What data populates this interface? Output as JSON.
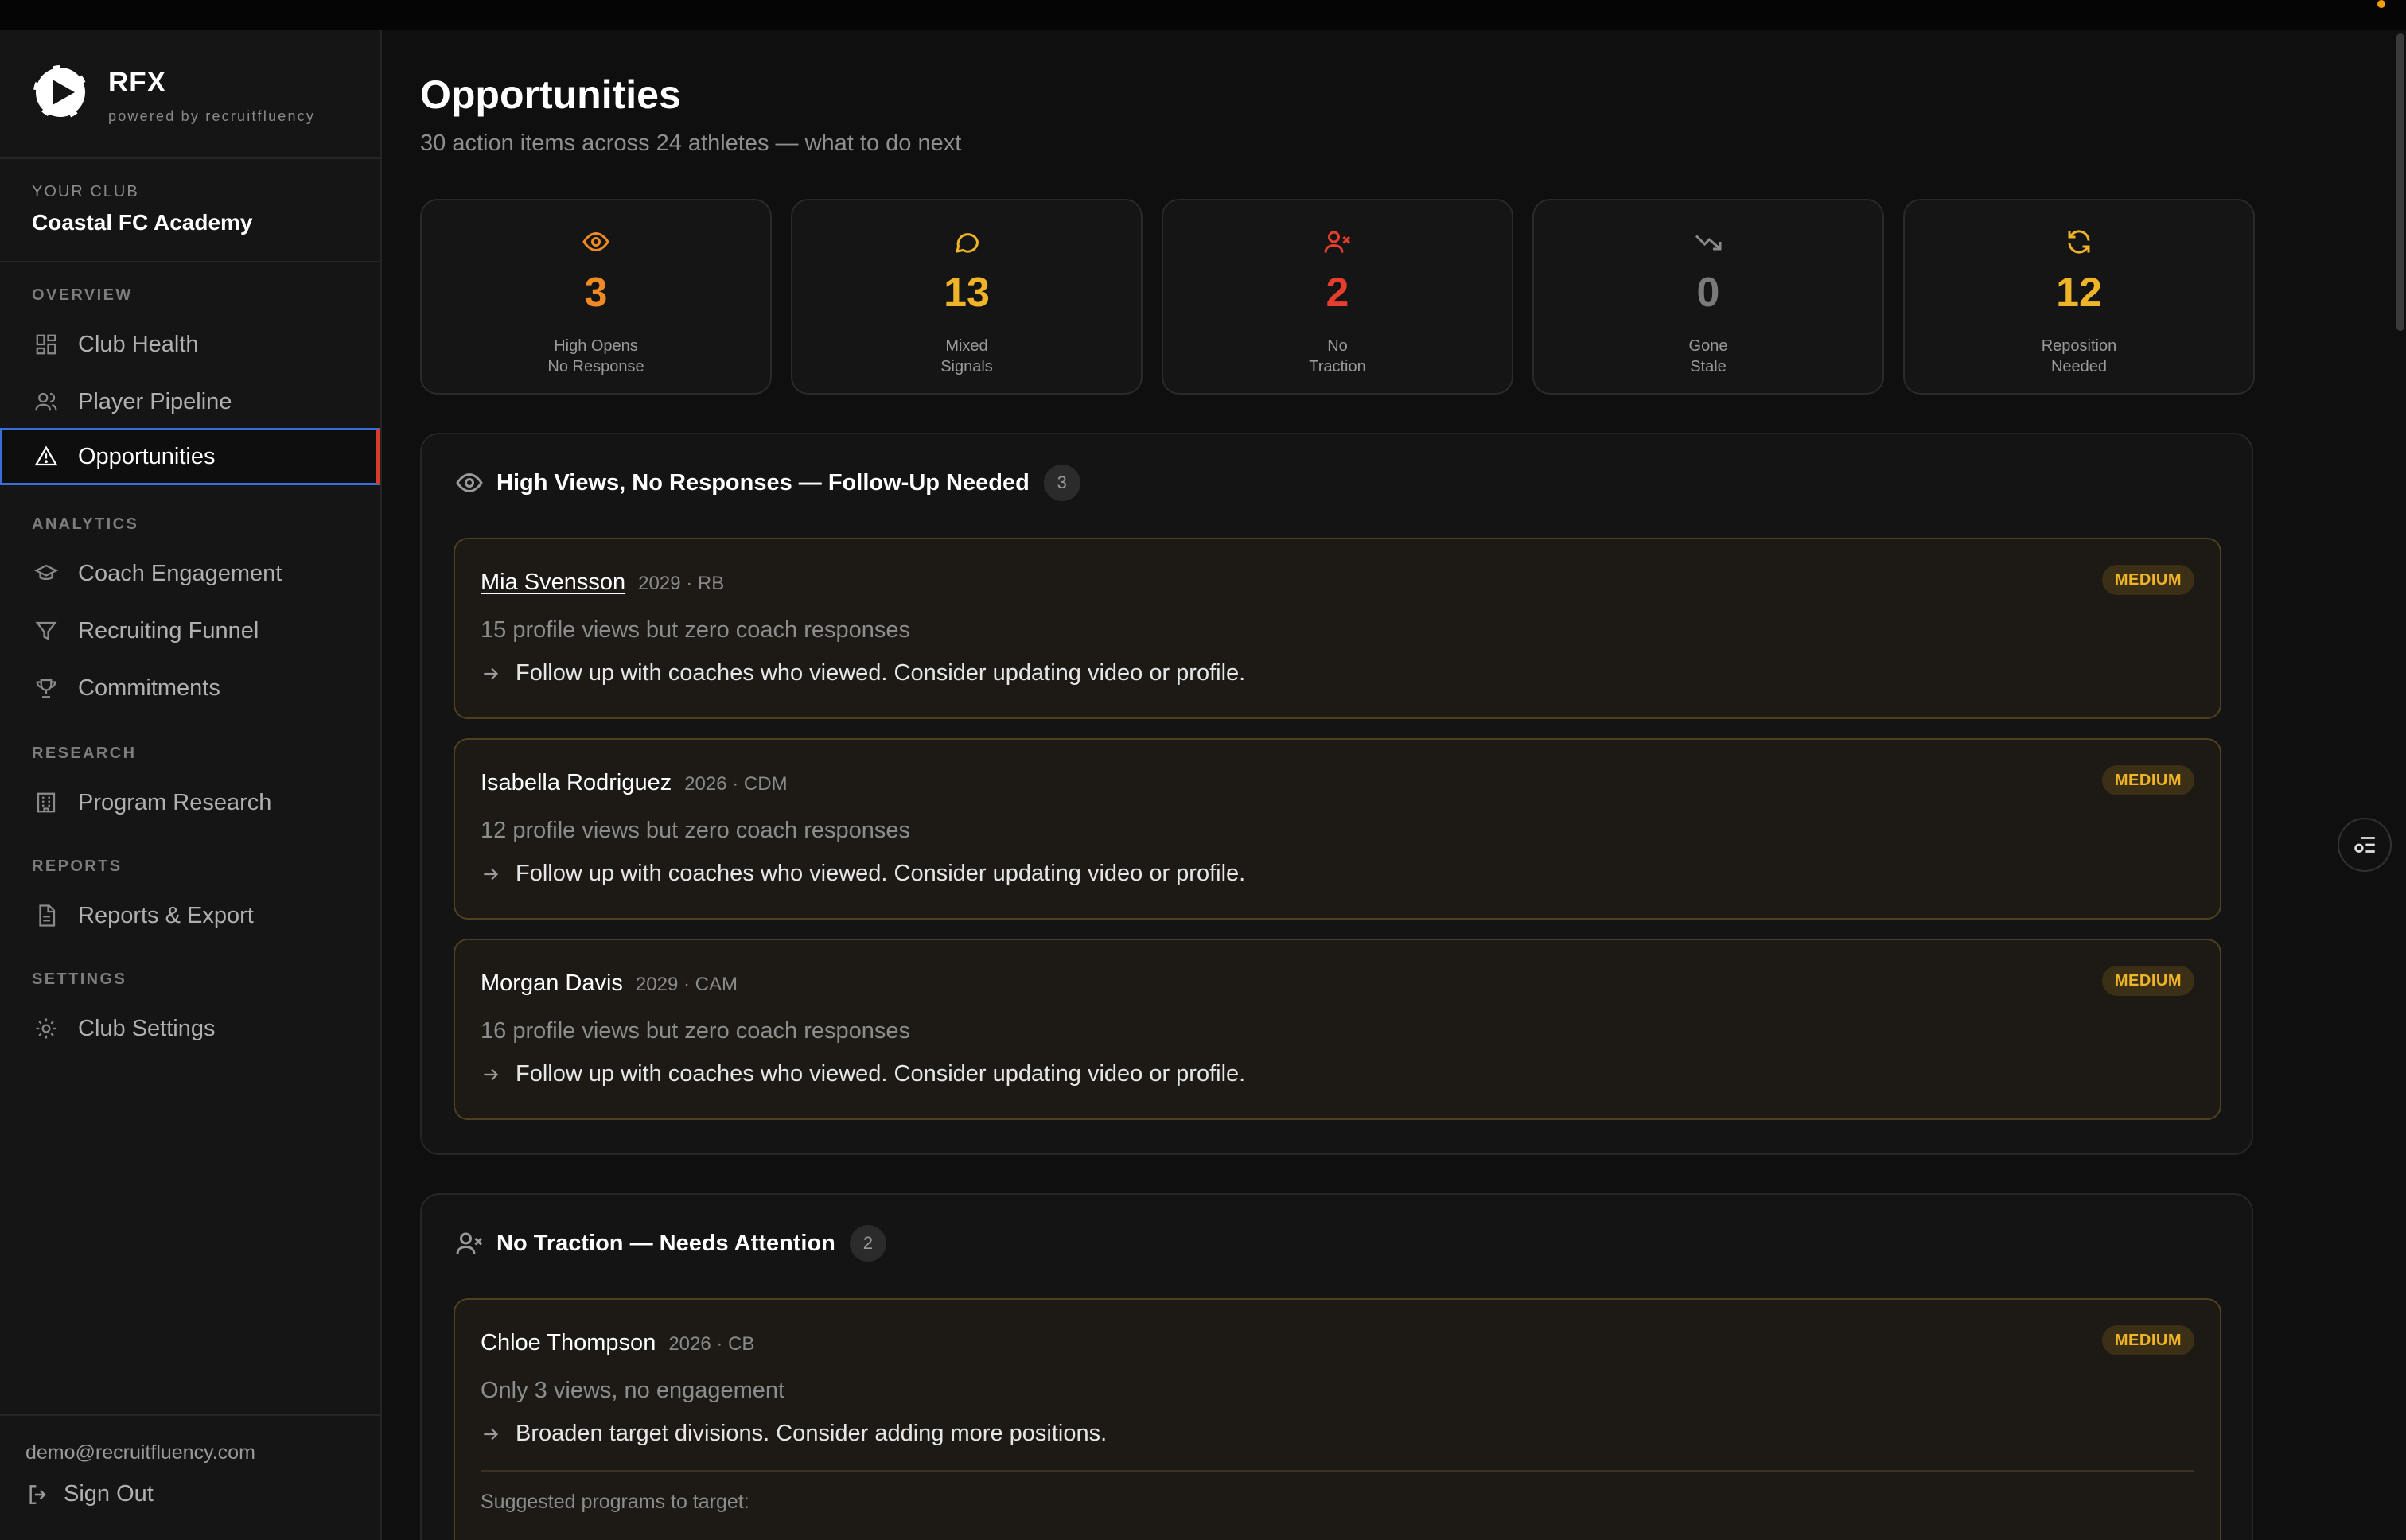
{
  "brand": {
    "name": "RFX",
    "tagline": "powered by recruitfluency"
  },
  "club": {
    "label": "YOUR CLUB",
    "name": "Coastal FC Academy"
  },
  "nav": {
    "overview": "OVERVIEW",
    "club_health": "Club Health",
    "player_pipeline": "Player Pipeline",
    "opportunities": "Opportunities",
    "analytics": "ANALYTICS",
    "coach_engagement": "Coach Engagement",
    "recruiting_funnel": "Recruiting Funnel",
    "commitments": "Commitments",
    "research": "RESEARCH",
    "program_research": "Program Research",
    "reports": "REPORTS",
    "reports_export": "Reports & Export",
    "settings": "SETTINGS",
    "club_settings": "Club Settings"
  },
  "user": {
    "email": "demo@recruitfluency.com",
    "sign_out": "Sign Out"
  },
  "page": {
    "title": "Opportunities",
    "subtitle": "30 action items across 24 athletes — what to do next"
  },
  "stats": [
    {
      "value": "3",
      "line1": "High Opens",
      "line2": "No Response",
      "color": "#f08a24",
      "icon": "eye-icon"
    },
    {
      "value": "13",
      "line1": "Mixed",
      "line2": "Signals",
      "color": "#f0b429",
      "icon": "message-icon"
    },
    {
      "value": "2",
      "line1": "No",
      "line2": "Traction",
      "color": "#e53e2e",
      "icon": "user-x-icon"
    },
    {
      "value": "0",
      "line1": "Gone",
      "line2": "Stale",
      "color": "#7a7a7a",
      "icon": "trending-down-icon"
    },
    {
      "value": "12",
      "line1": "Reposition",
      "line2": "Needed",
      "color": "#f0b429",
      "icon": "refresh-icon"
    }
  ],
  "sections": [
    {
      "title": "High Views, No Responses — Follow-Up Needed",
      "count": "3",
      "icon": "eye-icon",
      "items": [
        {
          "name": "Mia Svensson",
          "meta": "2029 · RB",
          "priority": "MEDIUM",
          "desc": "15 profile views but zero coach responses",
          "action": "Follow up with coaches who viewed. Consider updating video or profile."
        },
        {
          "name": "Isabella Rodriguez",
          "meta": "2026 · CDM",
          "priority": "MEDIUM",
          "desc": "12 profile views but zero coach responses",
          "action": "Follow up with coaches who viewed. Consider updating video or profile."
        },
        {
          "name": "Morgan Davis",
          "meta": "2029 · CAM",
          "priority": "MEDIUM",
          "desc": "16 profile views but zero coach responses",
          "action": "Follow up with coaches who viewed. Consider updating video or profile."
        }
      ]
    },
    {
      "title": "No Traction — Needs Attention",
      "count": "2",
      "icon": "user-x-icon",
      "items": [
        {
          "name": "Chloe Thompson",
          "meta": "2026 · CB",
          "priority": "MEDIUM",
          "desc": "Only 3 views, no engagement",
          "action": "Broaden target divisions. Consider adding more positions.",
          "suggested_label": "Suggested programs to target:"
        }
      ]
    }
  ],
  "colors": {
    "accent_active": "#d93b2b",
    "focus_ring": "#3b6fd8",
    "badge_text": "#f0b429"
  }
}
